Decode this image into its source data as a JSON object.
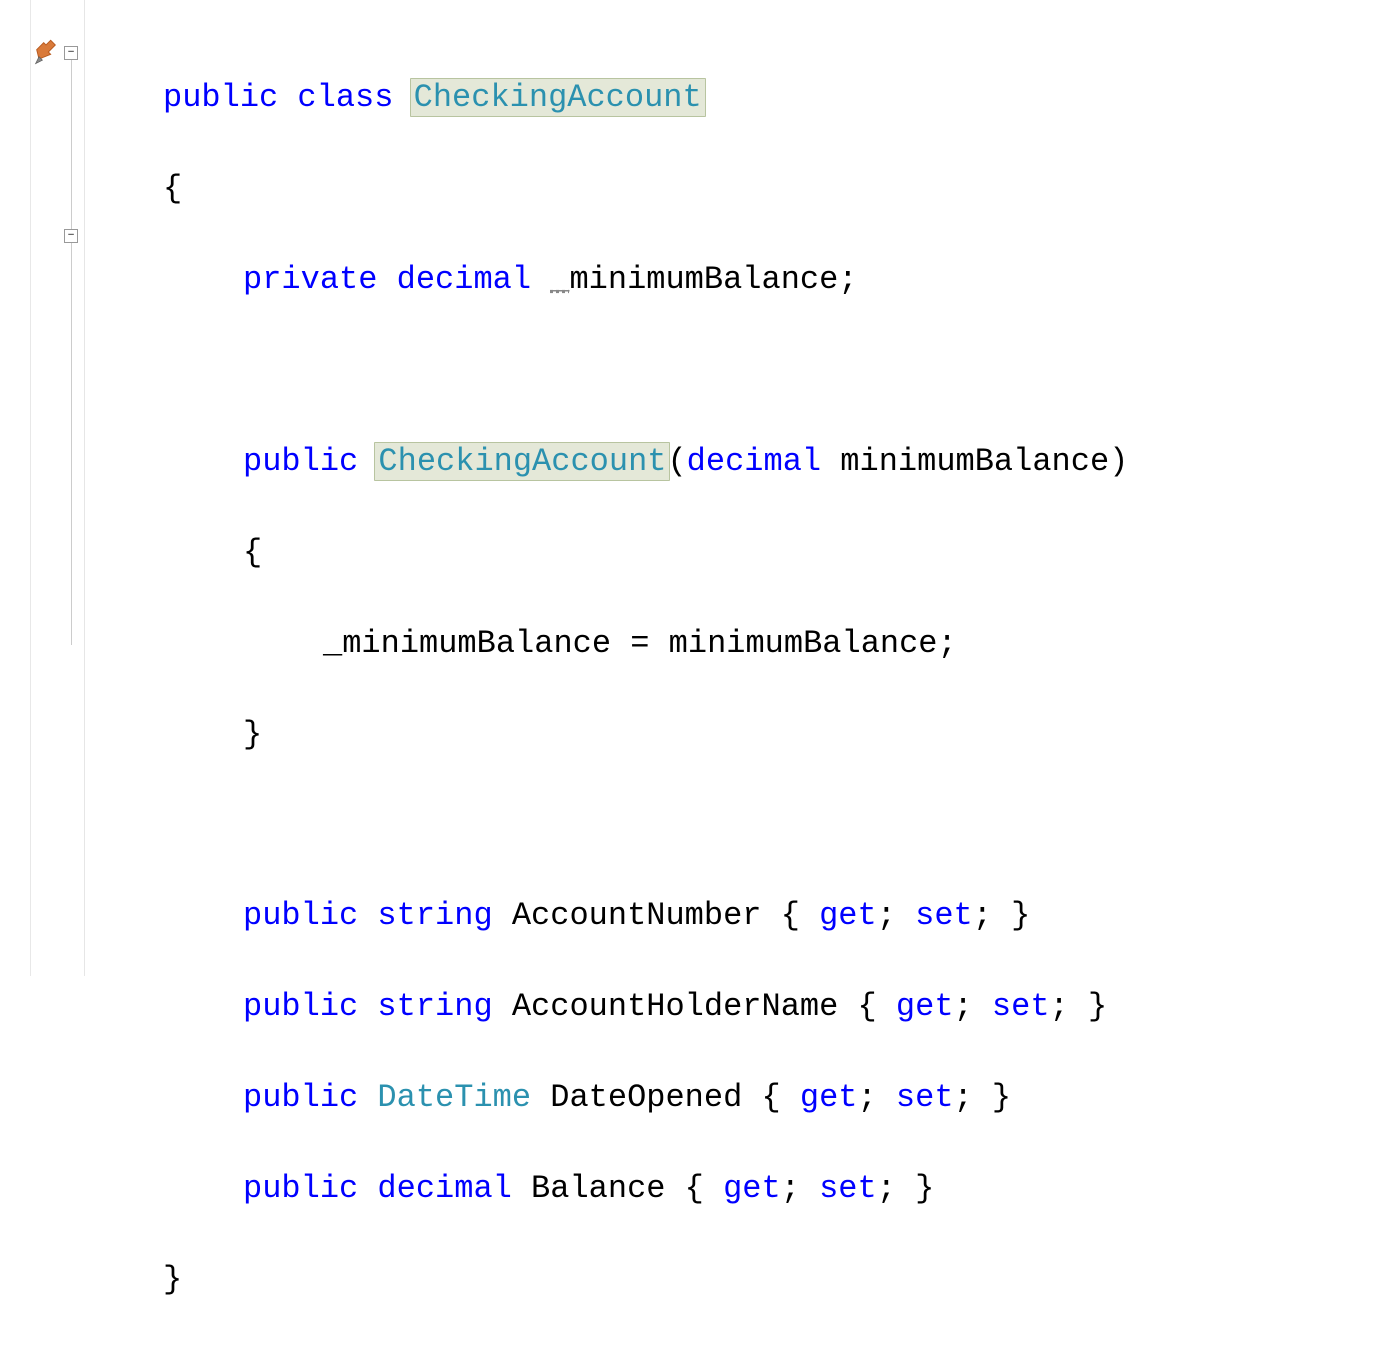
{
  "code": {
    "l1_public": "public",
    "l1_class": "class",
    "l1_name": "CheckingAccount",
    "l2": "{",
    "l3_private": "private",
    "l3_decimal": "decimal",
    "l3_underscore": "_",
    "l3_field": "minimumBalance",
    "l3_semi": ";",
    "l5_public": "public",
    "l5_name": "CheckingAccount",
    "l5_paren_open": "(",
    "l5_decimal": "decimal",
    "l5_param": " minimumBalance)",
    "l6": "{",
    "l7": "_minimumBalance = minimumBalance;",
    "l8": "}",
    "p1_public": "public",
    "p1_type": "string",
    "p1_rest": " AccountNumber { ",
    "p1_get": "get",
    "p1_mid": "; ",
    "p1_set": "set",
    "p1_end": "; }",
    "p2_public": "public",
    "p2_type": "string",
    "p2_rest": " AccountHolderName { ",
    "p2_get": "get",
    "p2_mid": "; ",
    "p2_set": "set",
    "p2_end": "; }",
    "p3_public": "public",
    "p3_type": "DateTime",
    "p3_rest": " DateOpened { ",
    "p3_get": "get",
    "p3_mid": "; ",
    "p3_set": "set",
    "p3_end": "; }",
    "p4_public": "public",
    "p4_type": "decimal",
    "p4_rest": " Balance { ",
    "p4_get": "get",
    "p4_mid": "; ",
    "p4_set": "set",
    "p4_end": "; }",
    "l_close": "}"
  }
}
